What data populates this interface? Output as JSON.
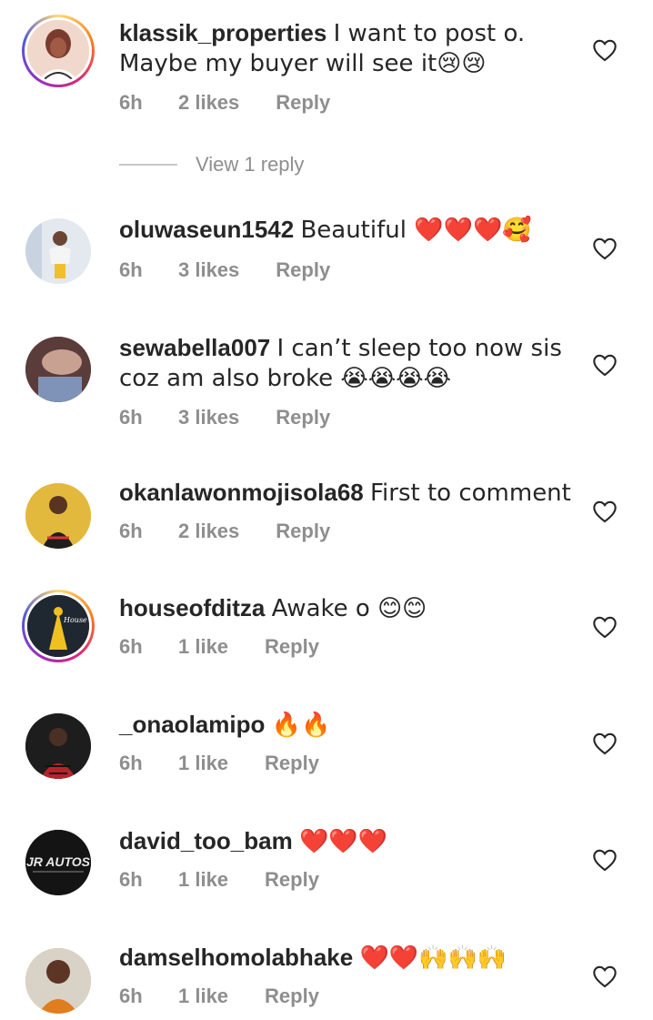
{
  "comments": [
    {
      "username": "klassik_properties",
      "text": "I want to post o. Maybe my buyer will see it😢😢",
      "time": "6h",
      "likes": "2 likes",
      "reply": "Reply",
      "story": true
    },
    {
      "username": "oluwaseun1542",
      "text": "Beautiful ❤️❤️❤️🥰",
      "time": "6h",
      "likes": "3 likes",
      "reply": "Reply",
      "story": false
    },
    {
      "username": "sewabella007",
      "text": "I can’t sleep too now sis coz am also broke 😭😭😭😭",
      "time": "6h",
      "likes": "3 likes",
      "reply": "Reply",
      "story": false
    },
    {
      "username": "okanlawonmojisola68",
      "text": "First to comment",
      "time": "6h",
      "likes": "2 likes",
      "reply": "Reply",
      "story": false
    },
    {
      "username": "houseofditza",
      "text": "Awake o 😊😊",
      "time": "6h",
      "likes": "1 like",
      "reply": "Reply",
      "story": true
    },
    {
      "username": "_onaolamipo",
      "text": "🔥🔥",
      "time": "6h",
      "likes": "1 like",
      "reply": "Reply",
      "story": false
    },
    {
      "username": "david_too_bam",
      "text": "❤️❤️❤️",
      "time": "6h",
      "likes": "1 like",
      "reply": "Reply",
      "story": false
    },
    {
      "username": "damselhomolabhake",
      "text": "❤️❤️🙌🙌🙌",
      "time": "6h",
      "likes": "1 like",
      "reply": "Reply",
      "story": false
    }
  ],
  "view_replies": "View 1 reply",
  "avatar_labels": {
    "david_too_bam": "JR AUTOS",
    "houseofditza": "House of Ditza"
  },
  "colors": {
    "text": "#262626",
    "meta": "#8e8e8e",
    "divider": "#c7c7c7"
  }
}
